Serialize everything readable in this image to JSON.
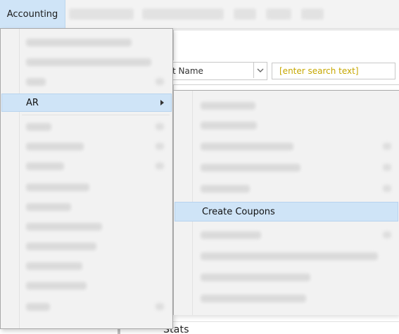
{
  "menubar": {
    "active_menu": "Accounting",
    "blurred_items": [
      "item-1",
      "item-2",
      "item-3",
      "item-4",
      "item-5"
    ]
  },
  "search_bar": {
    "field_dropdown_value": "t Name",
    "search_placeholder": "[enter search text]"
  },
  "dropdown": {
    "highlighted_label": "AR",
    "highlighted_has_submenu": true
  },
  "submenu": {
    "highlighted_label": "Create Coupons"
  },
  "footer": {
    "partial_label": "Stats"
  },
  "colors": {
    "menu_highlight": "#cfe4f7",
    "menu_highlight_border": "#b7d3ef",
    "menu_bg": "#f2f2f2",
    "search_placeholder": "#c6a700"
  },
  "icons": {
    "dropdown_chevron": "chevron-down-icon",
    "submenu_arrow": "chevron-right-icon"
  }
}
